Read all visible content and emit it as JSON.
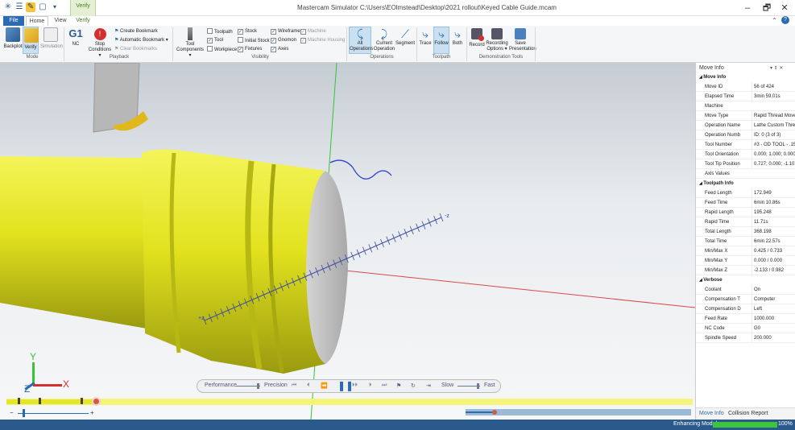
{
  "window": {
    "title": "Mastercam Simulator  C:\\Users\\EOlmstead\\Desktop\\2021 rollout\\Keyed Cable Guide.mcam",
    "contextual_tab_group": "Verify",
    "minimize": "–",
    "maximize": "🗗",
    "close": "✕"
  },
  "tabs": {
    "file": "File",
    "home": "Home",
    "view": "View",
    "verify": "Verify"
  },
  "ribbon": {
    "mode": {
      "group": "Mode",
      "backplot": "Backplot",
      "verify": "Verify",
      "simulation": "Simulation"
    },
    "playback": {
      "group": "Playback",
      "nc": "NC",
      "stop_conditions": "Stop Conditions ▾",
      "create_bookmark": "Create Bookmark",
      "automatic_bookmark": "Automatic Bookmark ▾",
      "clear_bookmarks": "Clear Bookmarks"
    },
    "visibility": {
      "group": "Visibility",
      "tool_components": "Tool Components ▾",
      "toolpath": "Toolpath",
      "tool": "Tool",
      "workpiece": "Workpiece",
      "stock": "Stock",
      "initial_stock": "Initial Stock",
      "fixtures": "Fixtures",
      "wireframe": "Wireframe",
      "gnomon": "Gnomon",
      "axes": "Axes",
      "machine": "Machine",
      "machine_housing": "Machine Housing"
    },
    "operations": {
      "group": "Operations",
      "all_operations": "All Operations",
      "current_operation": "Current Operation",
      "segment": "Segment"
    },
    "toolpath": {
      "group": "Toolpath",
      "trace": "Trace",
      "follow": "Follow",
      "both": "Both"
    },
    "demo": {
      "group": "Demonstration Tools",
      "record": "Record",
      "recording_options": "Recording Options ▾",
      "save_presentation": "Save Presentation"
    }
  },
  "viewport": {
    "axis_x": "X",
    "axis_y": "Y",
    "axis_z": "Z",
    "toolpath_label_pos": "-z",
    "toolpath_label_neg": "+z",
    "playback": {
      "performance": "Performance",
      "precision": "Precision",
      "slow": "Slow",
      "fast": "Fast"
    },
    "scale_minus": "−",
    "scale_plus": "+"
  },
  "panel": {
    "title": "Move Info",
    "pin": "▾ ⇕ ✕",
    "sections": [
      {
        "name": "Move Info",
        "rows": [
          {
            "k": "Move ID",
            "v": "56 of 424"
          },
          {
            "k": "Elapsed Time",
            "v": "3min 59.01s"
          },
          {
            "k": "Machine",
            "v": ""
          },
          {
            "k": "Move Type",
            "v": "Rapid Thread Move"
          },
          {
            "k": "Operation Name",
            "v": "Lathe Custom Threa"
          },
          {
            "k": "Operation Numb",
            "v": "ID: 0 (3 of 3)"
          },
          {
            "k": "Tool Number",
            "v": "#3 - OD TOOL - .156"
          },
          {
            "k": "Tool Orientation",
            "v": "0.000; 1.000; 0.000"
          },
          {
            "k": "Tool Tip Position",
            "v": "0.727; 0.000; -1.107"
          },
          {
            "k": "Axis Values",
            "v": ""
          }
        ]
      },
      {
        "name": "Toolpath Info",
        "rows": [
          {
            "k": "Feed Length",
            "v": "172.949"
          },
          {
            "k": "Feed Time",
            "v": "6min 10.86s"
          },
          {
            "k": "Rapid Length",
            "v": "195.248"
          },
          {
            "k": "Rapid Time",
            "v": "11.71s"
          },
          {
            "k": "Total Length",
            "v": "368.198"
          },
          {
            "k": "Total Time",
            "v": "6min 22.57s"
          },
          {
            "k": "Min/Max X",
            "v": "0.425 / 0.733"
          },
          {
            "k": "Min/Max Y",
            "v": "0.000 / 0.000"
          },
          {
            "k": "Min/Max Z",
            "v": "-2.133 / 0.982"
          }
        ]
      },
      {
        "name": "Verbose",
        "rows": [
          {
            "k": "Coolant",
            "v": "On"
          },
          {
            "k": "Compensation T",
            "v": "Computer"
          },
          {
            "k": "Compensation D",
            "v": "Left"
          },
          {
            "k": "Feed Rate",
            "v": "1000.000"
          },
          {
            "k": "NC Code",
            "v": "G0"
          },
          {
            "k": "Spindle Speed",
            "v": "200.000"
          }
        ]
      }
    ],
    "footer_tabs": [
      "Move Info",
      "Collision Report"
    ]
  },
  "status": {
    "text": "Enhancing Model",
    "percent": "100%",
    "progress_fraction": 1.0
  },
  "colors": {
    "accent": "#2b6cb0",
    "part_yellow": "#e8e82a",
    "status_bar": "#2a5a8c",
    "progress_green": "#3cc43c"
  }
}
